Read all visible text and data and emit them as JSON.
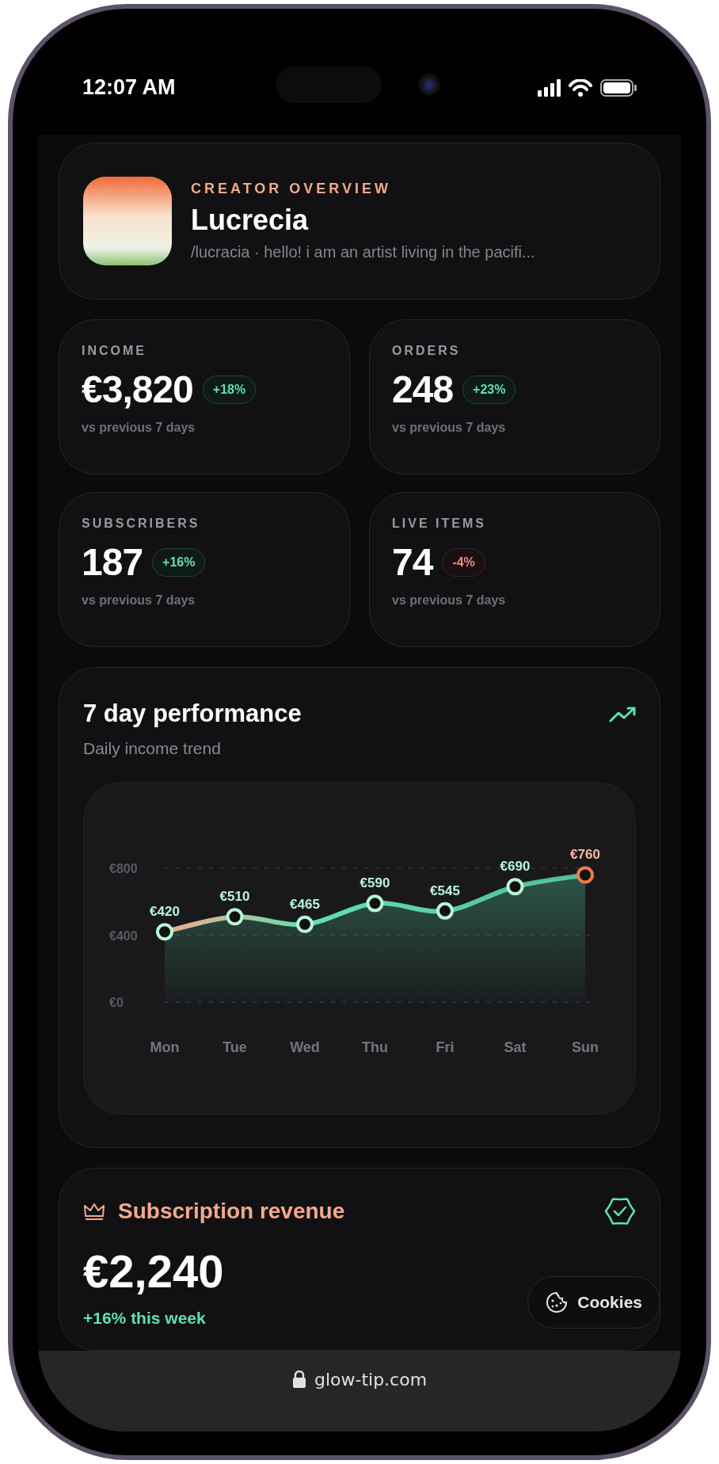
{
  "status_bar": {
    "time": "12:07 AM"
  },
  "profile": {
    "eyebrow": "CREATOR OVERVIEW",
    "name": "Lucrecia",
    "bio": "/lucracia · hello! i am an artist living in the pacifi..."
  },
  "stats": [
    {
      "label": "INCOME",
      "value": "€3,820",
      "change": "+18%",
      "kind": "up",
      "note": "vs previous 7 days"
    },
    {
      "label": "ORDERS",
      "value": "248",
      "change": "+23%",
      "kind": "up",
      "note": "vs previous 7 days"
    },
    {
      "label": "SUBSCRIBERS",
      "value": "187",
      "change": "+16%",
      "kind": "up",
      "note": "vs previous 7 days"
    },
    {
      "label": "LIVE ITEMS",
      "value": "74",
      "change": "-4%",
      "kind": "down",
      "note": "vs previous 7 days"
    }
  ],
  "performance": {
    "title": "7 day performance",
    "subtitle": "Daily income trend",
    "chart_data": {
      "type": "area",
      "categories": [
        "Mon",
        "Tue",
        "Wed",
        "Thu",
        "Fri",
        "Sat",
        "Sun"
      ],
      "series": [
        {
          "color": "#5fe0b0",
          "values": [
            420,
            510,
            465,
            590,
            545,
            690,
            760
          ]
        }
      ],
      "ylim": [
        0,
        800
      ],
      "yticks": [
        {
          "value": 0,
          "label": "€0"
        },
        {
          "value": 400,
          "label": "€400"
        },
        {
          "value": 800,
          "label": "€800"
        }
      ],
      "value_labels": [
        "€420",
        "€510",
        "€465",
        "€590",
        "€545",
        "€690",
        "€760"
      ]
    }
  },
  "subscription": {
    "title": "Subscription revenue",
    "value": "€2,240",
    "change": "+16% this week"
  },
  "cookies_button": {
    "label": "Cookies"
  },
  "address_bar": {
    "url": "glow-tip.com"
  }
}
